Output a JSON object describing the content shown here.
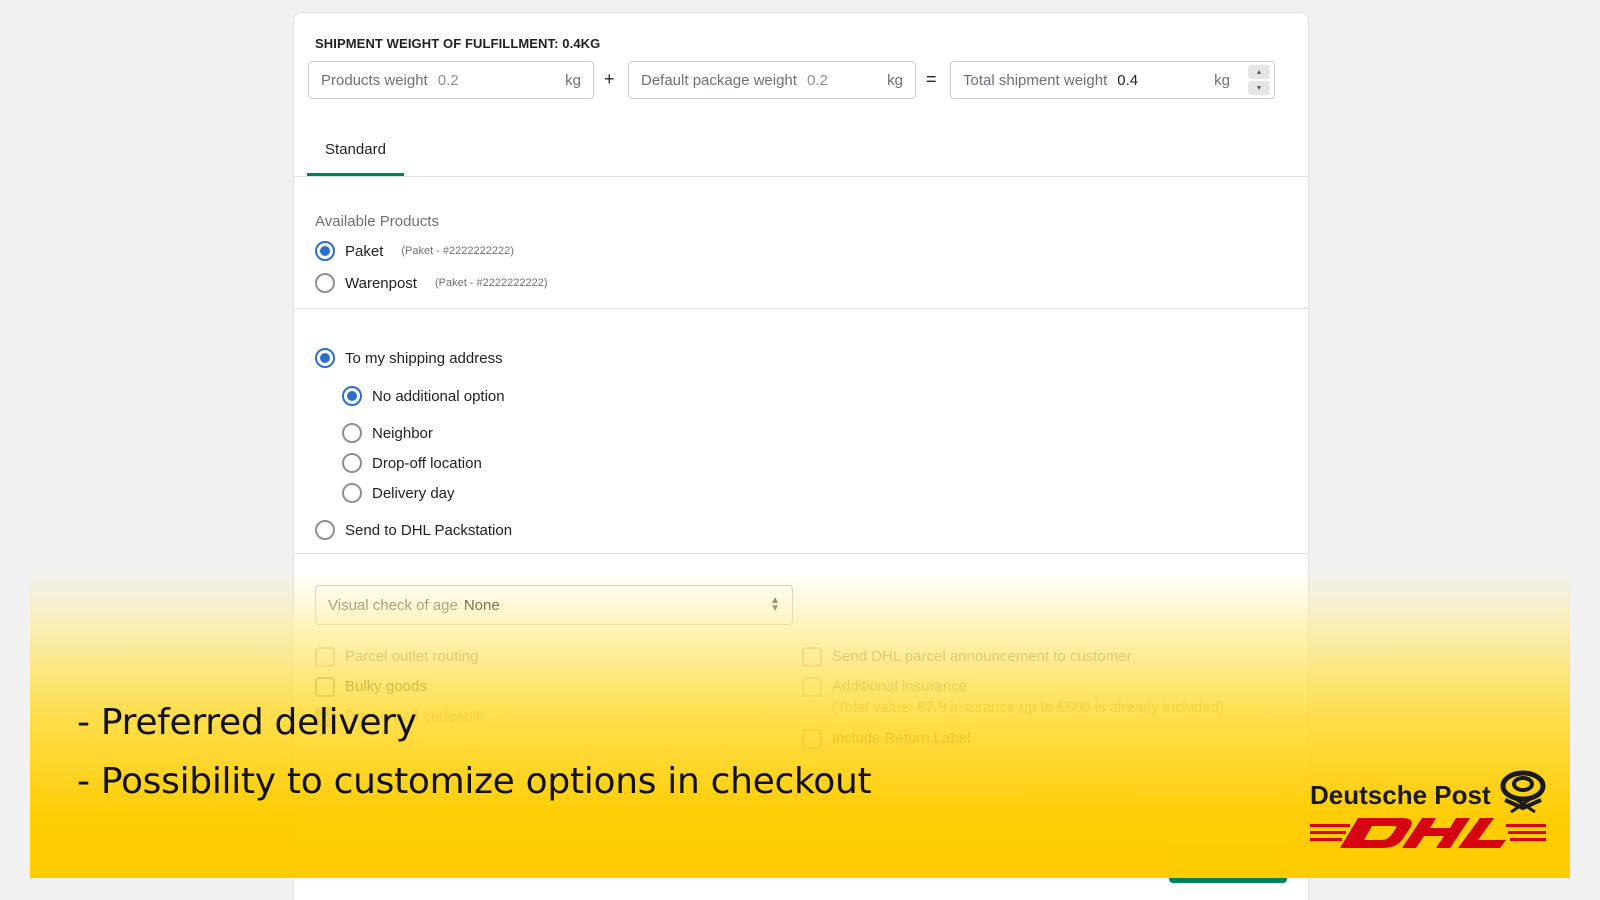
{
  "weight": {
    "title": "SHIPMENT WEIGHT OF FULFILLMENT: 0.4KG",
    "products_label": "Products weight",
    "products_value": "0.2",
    "package_label": "Default package weight",
    "package_value": "0.2",
    "total_label": "Total shipment weight",
    "total_value": "0.4",
    "unit": "kg",
    "plus": "+",
    "equals": "="
  },
  "tab": {
    "label": "Standard"
  },
  "products": {
    "label": "Available Products",
    "items": [
      {
        "name": "Paket",
        "sub": "(Paket - #2222222222)",
        "selected": true
      },
      {
        "name": "Warenpost",
        "sub": "(Paket - #2222222222)",
        "selected": false
      }
    ]
  },
  "delivery": {
    "shipping_address": "To my shipping address",
    "options": [
      {
        "label": "No additional option",
        "selected": true
      },
      {
        "label": "Neighbor",
        "selected": false
      },
      {
        "label": "Drop-off location",
        "selected": false
      },
      {
        "label": "Delivery day",
        "selected": false
      }
    ],
    "packstation": "Send to DHL Packstation"
  },
  "age_check": {
    "label": "Visual check of age",
    "value": "None"
  },
  "checkboxes": {
    "parcel_outlet": "Parcel outlet routing",
    "bulky": "Bulky goods",
    "print_codeable": "Print only if codeable",
    "announcement": "Send DHL parcel announcement to customer",
    "insurance": "Additional insurance",
    "insurance_note": "(Total value: €7.9 insurance up to €500 is already included)",
    "return_label": "Include Return Label"
  },
  "overlay": {
    "bullet1": "- Preferred delivery",
    "bullet2": "- Possibility to customize options in checkout",
    "brand_post": "Deutsche Post",
    "brand_dhl": "DHL"
  },
  "colors": {
    "accent": "#2c6ecb",
    "tab_underline": "#008060",
    "dhl_yellow": "#ffcc00",
    "dhl_red": "#d40511"
  }
}
